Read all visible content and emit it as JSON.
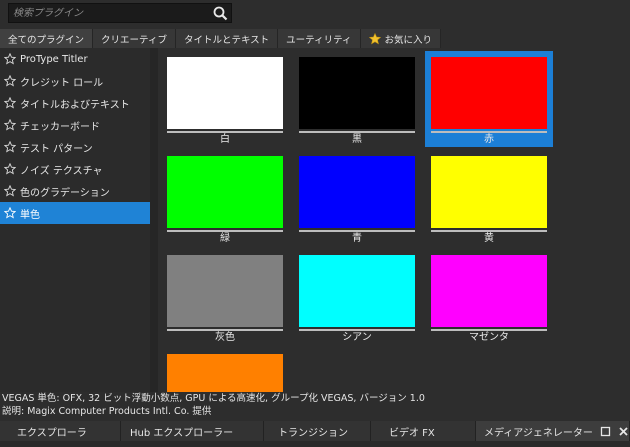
{
  "search": {
    "placeholder": "検索プラグイン",
    "icon": "search-icon"
  },
  "tabs": [
    {
      "label": "全てのプラグイン",
      "active": true
    },
    {
      "label": "クリエーティブ"
    },
    {
      "label": "タイトルとテキスト"
    },
    {
      "label": "ユーティリティ"
    },
    {
      "label": "お気に入り",
      "icon": "favorite-star-icon"
    }
  ],
  "sidebar": {
    "items": [
      {
        "label": "ProType Titler"
      },
      {
        "label": "クレジット ロール"
      },
      {
        "label": "タイトルおよびテキスト"
      },
      {
        "label": "チェッカーボード"
      },
      {
        "label": "テスト パターン"
      },
      {
        "label": "ノイズ テクスチャ"
      },
      {
        "label": "色のグラデーション"
      },
      {
        "label": "単色",
        "selected": true
      }
    ]
  },
  "presets": [
    {
      "label": "白",
      "color": "#ffffff"
    },
    {
      "label": "黒",
      "color": "#000000"
    },
    {
      "label": "赤",
      "color": "#ff0000",
      "selected": true
    },
    {
      "label": "緑",
      "color": "#00ff00"
    },
    {
      "label": "青",
      "color": "#0000ff"
    },
    {
      "label": "黄",
      "color": "#ffff00"
    },
    {
      "label": "灰色",
      "color": "#808080"
    },
    {
      "label": "シアン",
      "color": "#00ffff"
    },
    {
      "label": "マゼンタ",
      "color": "#ff00ff"
    },
    {
      "label": "",
      "color": "#ff8000"
    }
  ],
  "description": {
    "line1": "VEGAS 単色: OFX, 32 ビット浮動小数点, GPU による高速化, グループ化 VEGAS, バージョン 1.0",
    "line2": "説明: Magix Computer Products Intl. Co. 提供"
  },
  "bottom_tabs": [
    {
      "label": "エクスプローラ"
    },
    {
      "label": "Hub エクスプローラー"
    },
    {
      "label": "トランジション"
    },
    {
      "label": "ビデオ FX"
    },
    {
      "label": "メディアジェネレーター",
      "active": true
    }
  ],
  "colors": {
    "selection": "#1f83d6",
    "panel": "#2d2d2d"
  }
}
